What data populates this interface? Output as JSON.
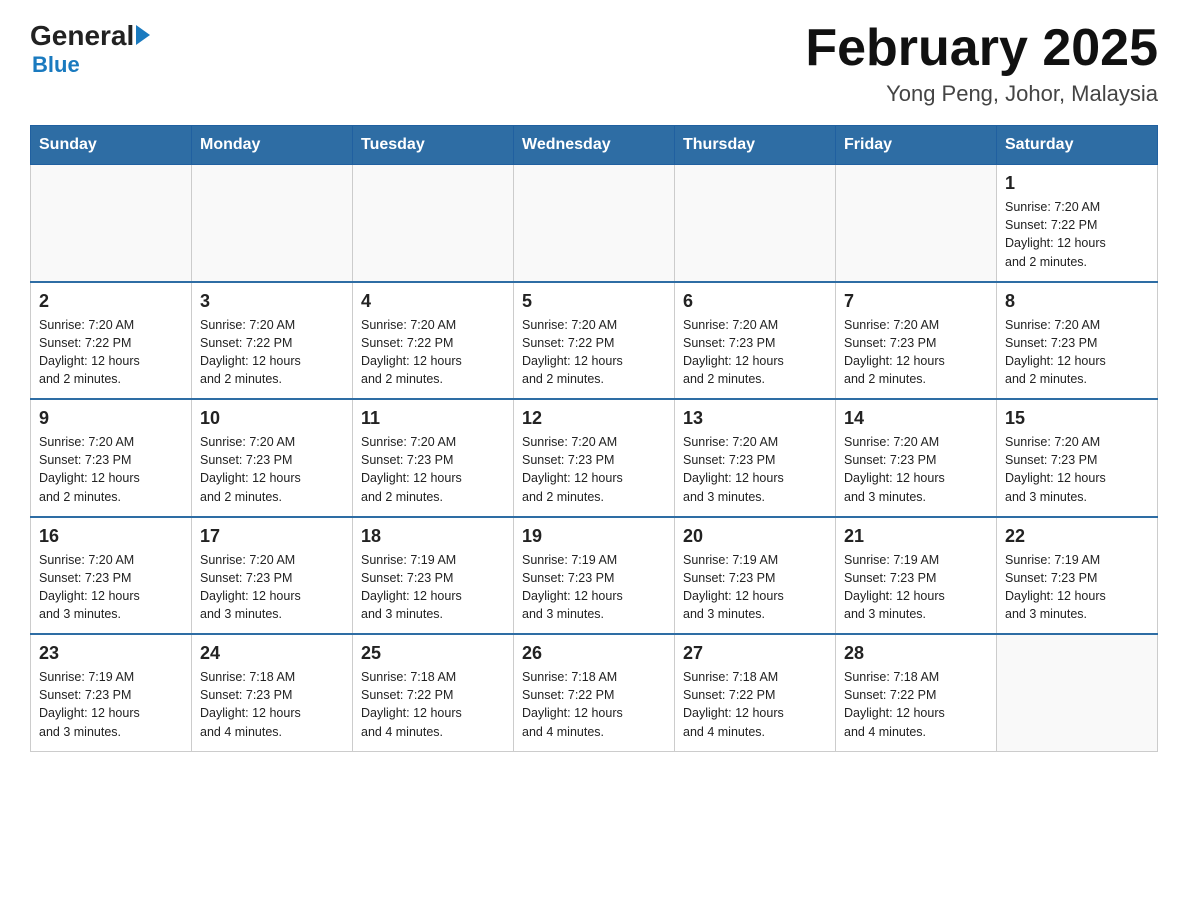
{
  "header": {
    "logo_general": "General",
    "logo_blue": "Blue",
    "title": "February 2025",
    "subtitle": "Yong Peng, Johor, Malaysia"
  },
  "weekdays": [
    "Sunday",
    "Monday",
    "Tuesday",
    "Wednesday",
    "Thursday",
    "Friday",
    "Saturday"
  ],
  "weeks": [
    [
      {
        "day": "",
        "info": ""
      },
      {
        "day": "",
        "info": ""
      },
      {
        "day": "",
        "info": ""
      },
      {
        "day": "",
        "info": ""
      },
      {
        "day": "",
        "info": ""
      },
      {
        "day": "",
        "info": ""
      },
      {
        "day": "1",
        "info": "Sunrise: 7:20 AM\nSunset: 7:22 PM\nDaylight: 12 hours\nand 2 minutes."
      }
    ],
    [
      {
        "day": "2",
        "info": "Sunrise: 7:20 AM\nSunset: 7:22 PM\nDaylight: 12 hours\nand 2 minutes."
      },
      {
        "day": "3",
        "info": "Sunrise: 7:20 AM\nSunset: 7:22 PM\nDaylight: 12 hours\nand 2 minutes."
      },
      {
        "day": "4",
        "info": "Sunrise: 7:20 AM\nSunset: 7:22 PM\nDaylight: 12 hours\nand 2 minutes."
      },
      {
        "day": "5",
        "info": "Sunrise: 7:20 AM\nSunset: 7:22 PM\nDaylight: 12 hours\nand 2 minutes."
      },
      {
        "day": "6",
        "info": "Sunrise: 7:20 AM\nSunset: 7:23 PM\nDaylight: 12 hours\nand 2 minutes."
      },
      {
        "day": "7",
        "info": "Sunrise: 7:20 AM\nSunset: 7:23 PM\nDaylight: 12 hours\nand 2 minutes."
      },
      {
        "day": "8",
        "info": "Sunrise: 7:20 AM\nSunset: 7:23 PM\nDaylight: 12 hours\nand 2 minutes."
      }
    ],
    [
      {
        "day": "9",
        "info": "Sunrise: 7:20 AM\nSunset: 7:23 PM\nDaylight: 12 hours\nand 2 minutes."
      },
      {
        "day": "10",
        "info": "Sunrise: 7:20 AM\nSunset: 7:23 PM\nDaylight: 12 hours\nand 2 minutes."
      },
      {
        "day": "11",
        "info": "Sunrise: 7:20 AM\nSunset: 7:23 PM\nDaylight: 12 hours\nand 2 minutes."
      },
      {
        "day": "12",
        "info": "Sunrise: 7:20 AM\nSunset: 7:23 PM\nDaylight: 12 hours\nand 2 minutes."
      },
      {
        "day": "13",
        "info": "Sunrise: 7:20 AM\nSunset: 7:23 PM\nDaylight: 12 hours\nand 3 minutes."
      },
      {
        "day": "14",
        "info": "Sunrise: 7:20 AM\nSunset: 7:23 PM\nDaylight: 12 hours\nand 3 minutes."
      },
      {
        "day": "15",
        "info": "Sunrise: 7:20 AM\nSunset: 7:23 PM\nDaylight: 12 hours\nand 3 minutes."
      }
    ],
    [
      {
        "day": "16",
        "info": "Sunrise: 7:20 AM\nSunset: 7:23 PM\nDaylight: 12 hours\nand 3 minutes."
      },
      {
        "day": "17",
        "info": "Sunrise: 7:20 AM\nSunset: 7:23 PM\nDaylight: 12 hours\nand 3 minutes."
      },
      {
        "day": "18",
        "info": "Sunrise: 7:19 AM\nSunset: 7:23 PM\nDaylight: 12 hours\nand 3 minutes."
      },
      {
        "day": "19",
        "info": "Sunrise: 7:19 AM\nSunset: 7:23 PM\nDaylight: 12 hours\nand 3 minutes."
      },
      {
        "day": "20",
        "info": "Sunrise: 7:19 AM\nSunset: 7:23 PM\nDaylight: 12 hours\nand 3 minutes."
      },
      {
        "day": "21",
        "info": "Sunrise: 7:19 AM\nSunset: 7:23 PM\nDaylight: 12 hours\nand 3 minutes."
      },
      {
        "day": "22",
        "info": "Sunrise: 7:19 AM\nSunset: 7:23 PM\nDaylight: 12 hours\nand 3 minutes."
      }
    ],
    [
      {
        "day": "23",
        "info": "Sunrise: 7:19 AM\nSunset: 7:23 PM\nDaylight: 12 hours\nand 3 minutes."
      },
      {
        "day": "24",
        "info": "Sunrise: 7:18 AM\nSunset: 7:23 PM\nDaylight: 12 hours\nand 4 minutes."
      },
      {
        "day": "25",
        "info": "Sunrise: 7:18 AM\nSunset: 7:22 PM\nDaylight: 12 hours\nand 4 minutes."
      },
      {
        "day": "26",
        "info": "Sunrise: 7:18 AM\nSunset: 7:22 PM\nDaylight: 12 hours\nand 4 minutes."
      },
      {
        "day": "27",
        "info": "Sunrise: 7:18 AM\nSunset: 7:22 PM\nDaylight: 12 hours\nand 4 minutes."
      },
      {
        "day": "28",
        "info": "Sunrise: 7:18 AM\nSunset: 7:22 PM\nDaylight: 12 hours\nand 4 minutes."
      },
      {
        "day": "",
        "info": ""
      }
    ]
  ]
}
